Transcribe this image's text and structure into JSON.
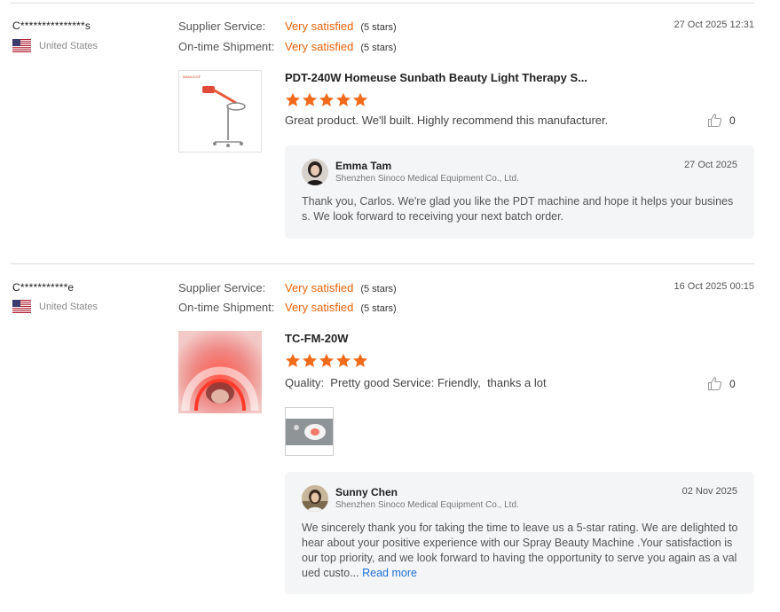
{
  "reviews": [
    {
      "buyer": "C***************s",
      "country": "United States",
      "supplier_service_label": "Supplier Service:",
      "supplier_service_value": "Very satisfied",
      "supplier_service_stars": "(5 stars)",
      "shipment_label": "On-time Shipment:",
      "shipment_value": "Very satisfied",
      "shipment_stars": "(5 stars)",
      "date": "27 Oct 2025 12:31",
      "product_title": "PDT-240W Homeuse Sunbath Beauty Light Therapy S...",
      "rating": 5,
      "comment": "Great product. We'll built. Highly recommend this manufacturer.",
      "likes": "0",
      "thumb_label": "MANUCOF",
      "reply": {
        "name": "Emma Tam",
        "company": "Shenzhen Sinoco Medical Equipment Co., Ltd.",
        "date": "27 Oct 2025",
        "text": "Thank you, Carlos. We're glad you like the PDT machine and hope it helps your business. We look forward to receiving your next batch order."
      }
    },
    {
      "buyer": "C***********e",
      "country": "United States",
      "supplier_service_label": "Supplier Service:",
      "supplier_service_value": "Very satisfied",
      "supplier_service_stars": "(5 stars)",
      "shipment_label": "On-time Shipment:",
      "shipment_value": "Very satisfied",
      "shipment_stars": "(5 stars)",
      "date": "16 Oct 2025 00:15",
      "product_title": "TC-FM-20W",
      "rating": 5,
      "comment": "Quality:  Pretty good Service: Friendly,  thanks a lot",
      "likes": "0",
      "reply": {
        "name": "Sunny Chen",
        "company": "Shenzhen Sinoco Medical Equipment Co., Ltd.",
        "date": "02 Nov 2025",
        "text": "We sincerely thank you for taking the time to leave us a 5-star rating. We are delighted to hear about your positive experience with our Spray Beauty Machine .Your satisfaction is our top priority, and we look forward to having the opportunity to serve you again as a valued custo...",
        "read_more": "Read more"
      }
    }
  ],
  "colors": {
    "accent": "#e8620a",
    "link": "#1e6fd9",
    "reply_bg": "#f4f5f7",
    "divider": "#dcdcdc"
  },
  "icons": {
    "star": "star-icon",
    "like": "thumbs-up-icon",
    "flag": "us-flag-icon"
  }
}
